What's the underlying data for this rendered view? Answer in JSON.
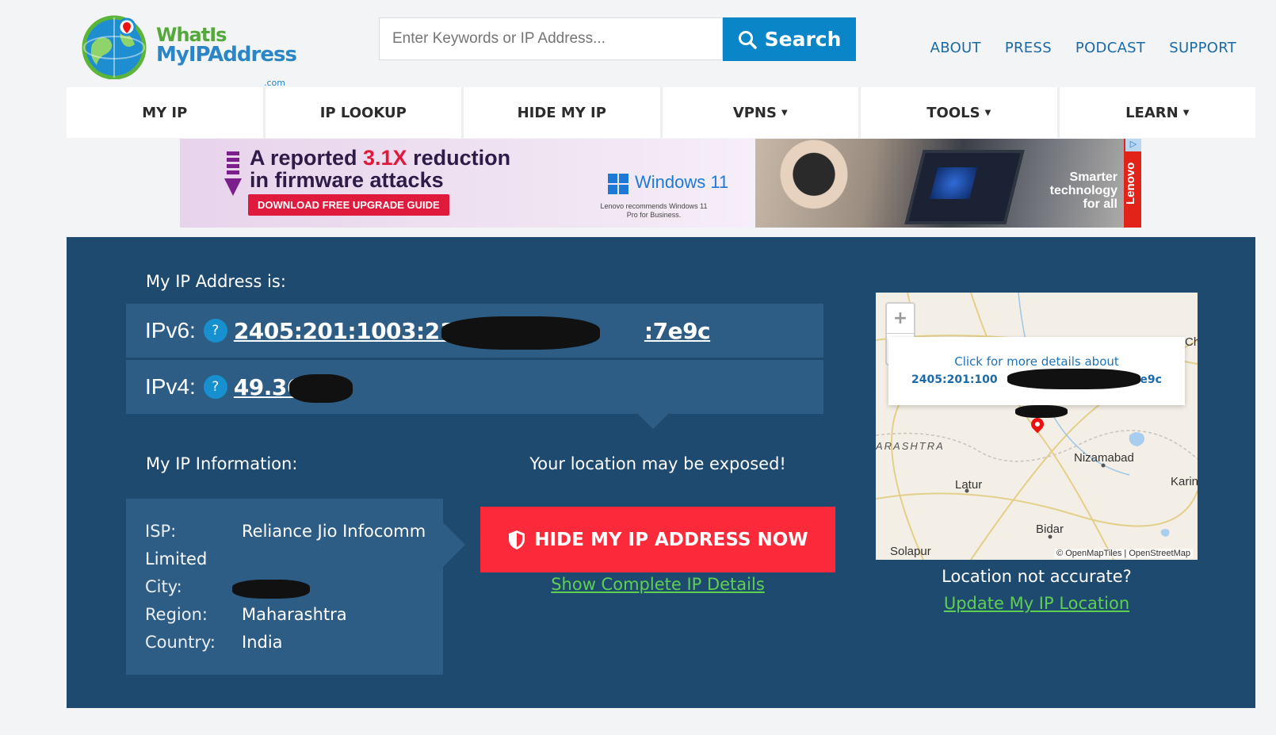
{
  "header": {
    "logo": {
      "line1": "WhatIs",
      "line2": "MyIPAddress",
      "suffix": ".com"
    },
    "search": {
      "placeholder": "Enter Keywords or IP Address...",
      "button_label": "Search"
    },
    "top_links": [
      "ABOUT",
      "PRESS",
      "PODCAST",
      "SUPPORT"
    ]
  },
  "main_nav": [
    {
      "label": "MY IP",
      "dropdown": false
    },
    {
      "label": "IP LOOKUP",
      "dropdown": false
    },
    {
      "label": "HIDE MY IP",
      "dropdown": false
    },
    {
      "label": "VPNS",
      "dropdown": true
    },
    {
      "label": "TOOLS",
      "dropdown": true
    },
    {
      "label": "LEARN",
      "dropdown": true
    }
  ],
  "ad": {
    "headline_pre": "A reported ",
    "headline_highlight": "3.1X",
    "headline_post": " reduction",
    "headline_line2": "in firmware attacks",
    "cta": "DOWNLOAD FREE UPGRADE GUIDE",
    "windows_label": "Windows 11",
    "windows_sub": "Lenovo recommends Windows 11 Pro for Business.",
    "tagline": [
      "Smarter",
      "technology",
      "for all"
    ],
    "brand": "Lenovo"
  },
  "ip_panel": {
    "title": "My IP Address is:",
    "ipv6_label": "IPv6:",
    "ipv6_value_start": "2405:201:1003:213b:",
    "ipv6_value_end": ":7e9c",
    "ipv4_label": "IPv4:",
    "ipv4_value": "49.36",
    "help_glyph": "?"
  },
  "ip_info": {
    "title": "My IP Information:",
    "isp_label": "ISP:",
    "isp_value_line1": "Reliance Jio Infocomm",
    "isp_value_line2": "Limited",
    "city_label": "City:",
    "region_label": "Region:",
    "region_value": "Maharashtra",
    "country_label": "Country:",
    "country_value": "India"
  },
  "cta": {
    "exposed_text": "Your location may be exposed!",
    "hide_button": "HIDE MY IP ADDRESS NOW",
    "details_link": "Show Complete IP Details"
  },
  "map": {
    "popup_line1": "Click for more details about",
    "popup_ip_start": "2405:201:100",
    "popup_ip_end": "7e9c",
    "zoom_in": "+",
    "zoom_out": "−",
    "cities": [
      "ARASHTRA",
      "Nizamabad",
      "Latur",
      "Karin",
      "Bidar",
      "Solapur",
      "Ch"
    ],
    "attribution": "© OpenMapTiles | OpenStreetMap"
  },
  "location": {
    "question": "Location not accurate?",
    "update_link": "Update My IP Location"
  },
  "colors": {
    "brand_blue": "#0a86c8",
    "panel_bg": "#1f4a70",
    "row_bg": "#2d5c84",
    "hide_red": "#fb2a3a",
    "link_green": "#5fcf52"
  }
}
